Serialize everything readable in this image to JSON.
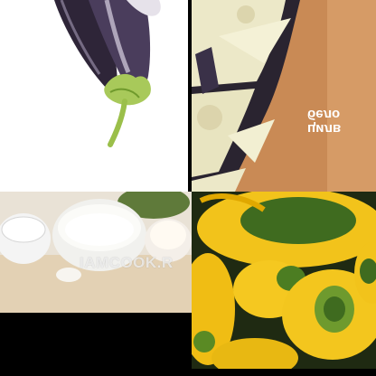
{
  "panels": [
    {
      "subject": "eggplant"
    },
    {
      "subject": "sliced-eggplant-on-board"
    },
    {
      "subject": "flour-and-bowls"
    },
    {
      "subject": "pattypan-squash"
    }
  ],
  "watermark": "IAMCOOK.R",
  "board_text_line1": "цилв",
  "board_text_line2": "бело",
  "colors": {
    "eggplant": "#3b2f4a",
    "stem": "#9bbf4a",
    "board": "#c98a55",
    "squash_yellow": "#f2c31b",
    "squash_green": "#3f6b1f"
  }
}
